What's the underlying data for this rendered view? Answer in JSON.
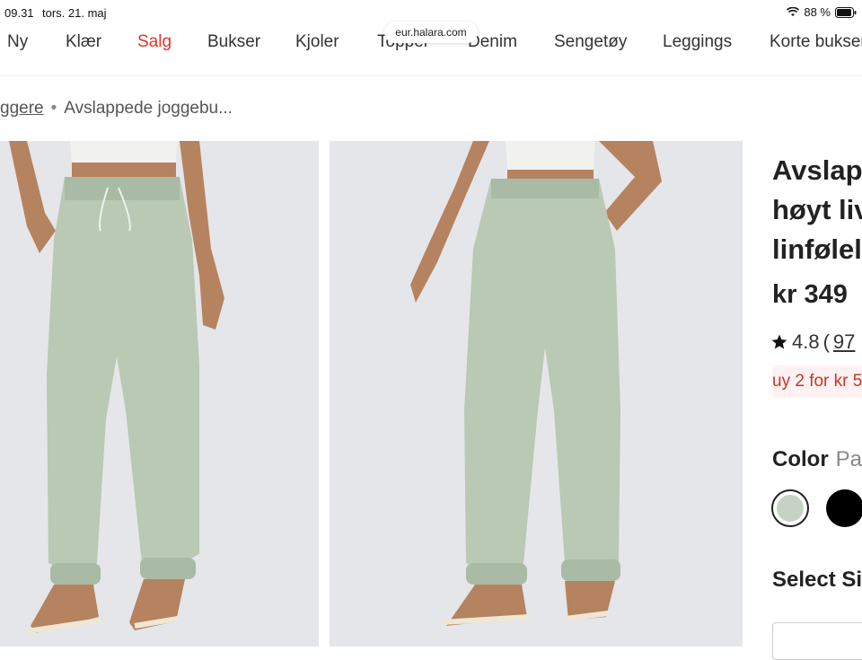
{
  "status": {
    "time": "09.31",
    "date": "tors. 21. maj",
    "battery": "88 %"
  },
  "browser": {
    "url": "eur.halara.com"
  },
  "nav": {
    "items": [
      "Ny",
      "Klær",
      "Salg",
      "Bukser",
      "Kjoler",
      "Topper",
      "Denim",
      "Sengetøy",
      "Leggings",
      "Korte bukser"
    ]
  },
  "breadcrumb": {
    "parent": "ggere",
    "separator": "•",
    "current": "Avslappede joggebu..."
  },
  "product": {
    "title_lines": [
      "Avslap",
      "høyt liv",
      "linfølel"
    ],
    "price": "kr 349",
    "rating": "4.8",
    "rating_open": "(",
    "review_count": "97",
    "promo": "uy 2 for kr 5",
    "color_label": "Color",
    "color_value": "Pa",
    "size_label": "Select Si",
    "swatches": [
      {
        "name": "pale-green",
        "color": "#c6d3c4"
      },
      {
        "name": "black",
        "color": "#000000"
      }
    ]
  },
  "colors": {
    "sale": "#e0352b",
    "pants": "#b9c9b4",
    "promo_bg": "#fdf1f1",
    "promo_text": "#c0392b"
  }
}
